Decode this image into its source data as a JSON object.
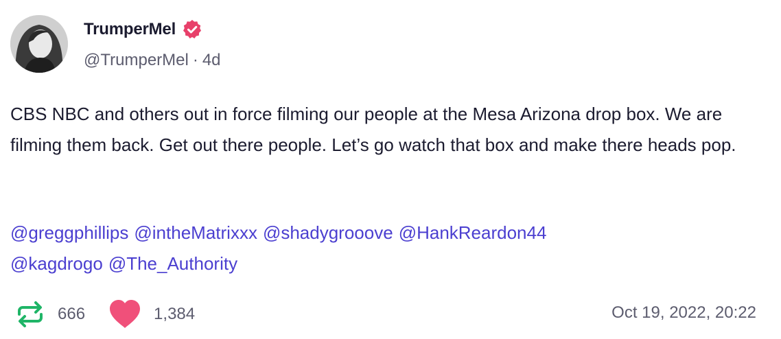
{
  "author": {
    "display_name": "TrumperMel",
    "handle": "@TrumperMel",
    "separator": "·",
    "age": "4d",
    "verified_color": "#e8406a"
  },
  "post": {
    "text": "CBS NBC and others out in force filming our people at the Mesa Arizona drop box. We are filming them back. Get out there people. Let’s go watch that box and make there heads pop.",
    "mentions": [
      "@greggphillips",
      "@intheMatrixxx",
      "@shadygrooove",
      "@HankReardon44",
      "@kagdrogo",
      "@The_Authority"
    ],
    "mention_color": "#4b3fd0"
  },
  "stats": {
    "reposts": "666",
    "likes": "1,384",
    "repost_color": "#1fb567",
    "like_color": "#f0507a"
  },
  "timestamp": "Oct 19, 2022, 20:22"
}
